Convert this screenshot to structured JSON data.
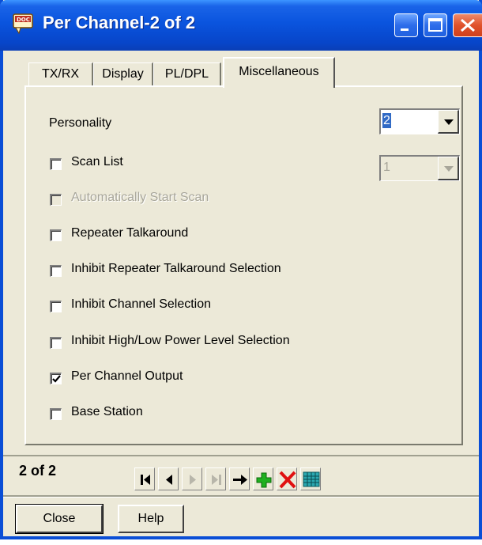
{
  "window": {
    "title": "Per Channel-2 of 2"
  },
  "tabs": [
    {
      "label": "TX/RX",
      "active": false
    },
    {
      "label": "Display",
      "active": false
    },
    {
      "label": "PL/DPL",
      "active": false
    },
    {
      "label": "Miscellaneous",
      "active": true
    }
  ],
  "personality": {
    "label": "Personality",
    "value": "2"
  },
  "scan_list": {
    "label": "Scan List",
    "checked": false,
    "value": "1"
  },
  "options": [
    {
      "label": "Automatically Start Scan",
      "checked": false,
      "disabled": true
    },
    {
      "label": "Repeater Talkaround",
      "checked": false,
      "disabled": false
    },
    {
      "label": "Inhibit Repeater Talkaround Selection",
      "checked": false,
      "disabled": false
    },
    {
      "label": "Inhibit Channel Selection",
      "checked": false,
      "disabled": false
    },
    {
      "label": "Inhibit High/Low Power Level Selection",
      "checked": false,
      "disabled": false
    },
    {
      "label": "Per Channel Output",
      "checked": true,
      "disabled": false
    },
    {
      "label": "Base Station",
      "checked": false,
      "disabled": false
    }
  ],
  "record": {
    "position_text": "2 of 2"
  },
  "toolbar_icons": [
    "first-record-icon",
    "previous-record-icon",
    "next-record-icon",
    "last-record-icon",
    "go-to-icon",
    "add-record-icon",
    "delete-record-icon",
    "table-view-icon"
  ],
  "buttons": {
    "close_label": "Close",
    "help_label": "Help"
  },
  "colors": {
    "title_bar": "#0a54de",
    "window_bg": "#ece9d8",
    "selection": "#316ac5",
    "add_green": "#20b020",
    "delete_red": "#e01010"
  }
}
